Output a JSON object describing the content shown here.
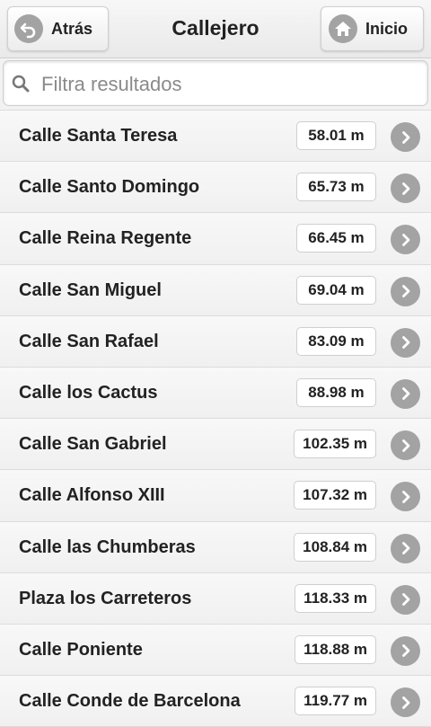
{
  "header": {
    "title": "Callejero",
    "back_label": "Atrás",
    "home_label": "Inicio"
  },
  "search": {
    "placeholder": "Filtra resultados",
    "value": ""
  },
  "streets": [
    {
      "name": "Calle Santa Teresa",
      "distance": "58.01 m"
    },
    {
      "name": "Calle Santo Domingo",
      "distance": "65.73 m"
    },
    {
      "name": "Calle Reina Regente",
      "distance": "66.45 m"
    },
    {
      "name": "Calle San Miguel",
      "distance": "69.04 m"
    },
    {
      "name": "Calle San Rafael",
      "distance": "83.09 m"
    },
    {
      "name": "Calle los Cactus",
      "distance": "88.98 m"
    },
    {
      "name": "Calle San Gabriel",
      "distance": "102.35 m"
    },
    {
      "name": "Calle Alfonso XIII",
      "distance": "107.32 m"
    },
    {
      "name": "Calle las Chumberas",
      "distance": "108.84 m"
    },
    {
      "name": "Plaza los Carreteros",
      "distance": "118.33 m"
    },
    {
      "name": "Calle Poniente",
      "distance": "118.88 m"
    },
    {
      "name": "Calle Conde de Barcelona",
      "distance": "119.77 m"
    }
  ],
  "icons": {
    "back": "back-arrow-icon",
    "home": "home-icon",
    "search": "search-icon",
    "row": "chevron-right-icon"
  },
  "colors": {
    "icon_gray": "#a3a3a3",
    "background": "#f2f2f2"
  }
}
